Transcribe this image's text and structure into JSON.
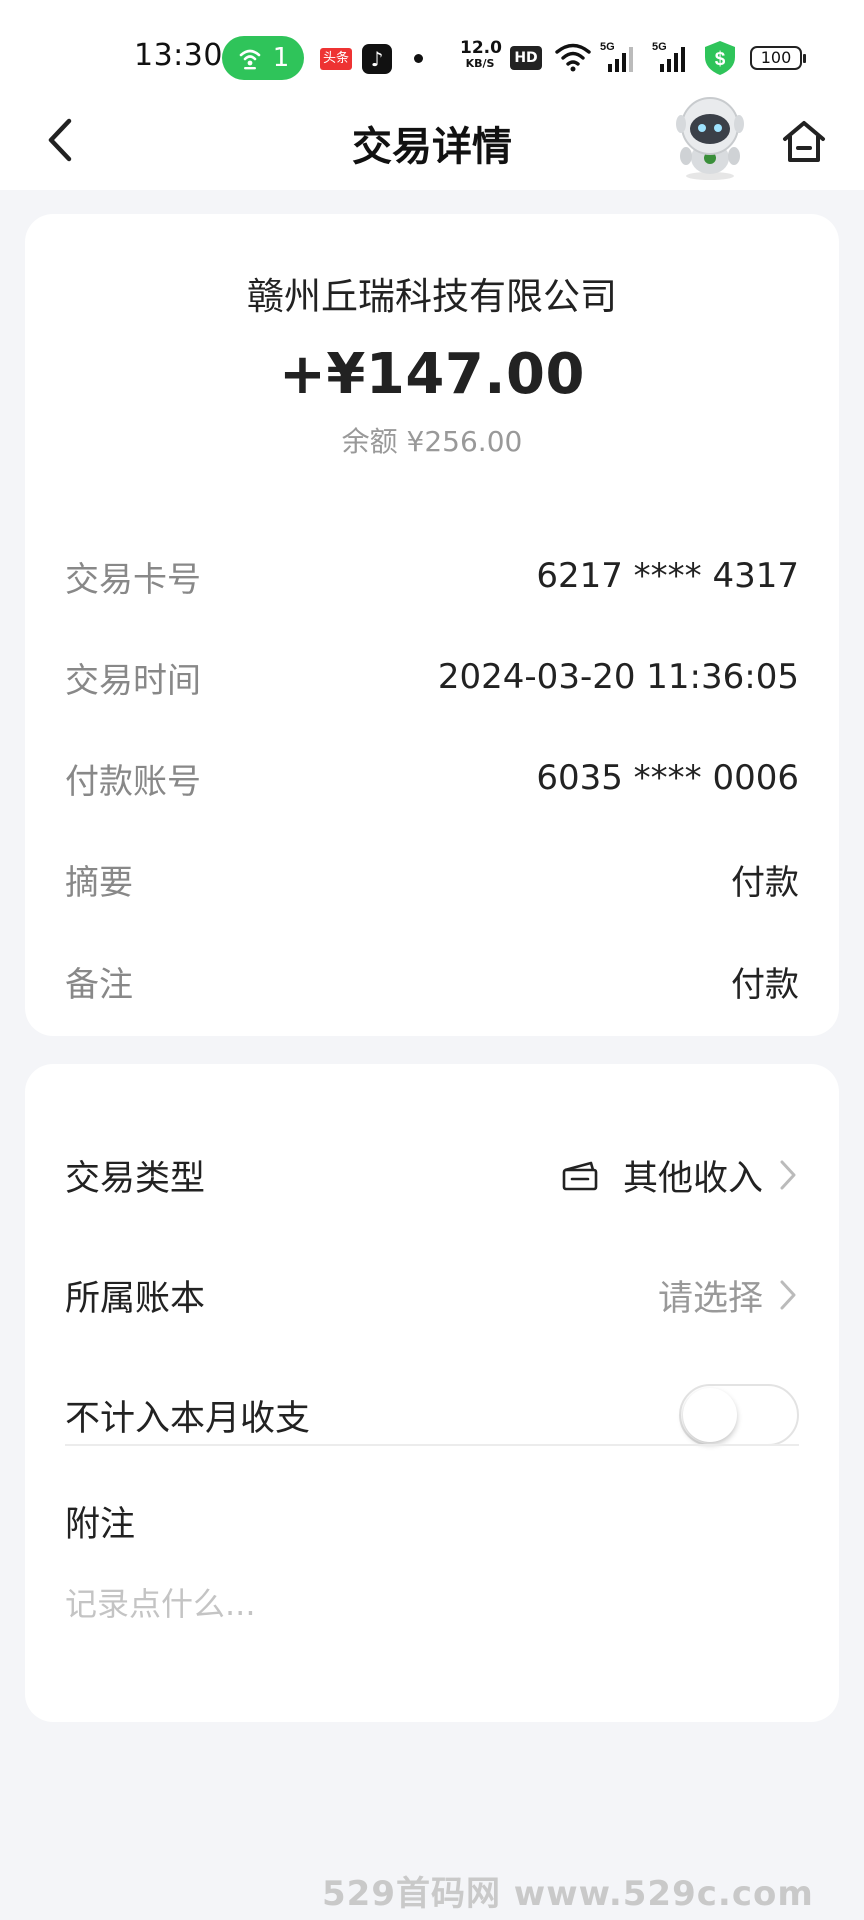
{
  "status_bar": {
    "time": "13:30",
    "hotspot_count": "1",
    "toutiao_label": "头条",
    "net_speed_value": "12.0",
    "net_speed_unit": "KB/S",
    "hd_label": "HD",
    "battery": "100",
    "icons": [
      "hotspot-icon",
      "toutiao-icon",
      "tiktok-icon",
      "wifi-icon",
      "signal-5g-icon",
      "signal-5g-icon",
      "security-shield-icon",
      "battery-icon"
    ]
  },
  "nav": {
    "title": "交易详情",
    "back_icon": "chevron-left-icon",
    "assistant_icon": "robot-assistant-icon",
    "home_icon": "home-icon"
  },
  "transaction": {
    "merchant": "赣州丘瑞科技有限公司",
    "amount": "+¥147.00",
    "balance": "余额 ¥256.00",
    "details": [
      {
        "label": "交易卡号",
        "value": "6217 **** 4317"
      },
      {
        "label": "交易时间",
        "value": "2024-03-20 11:36:05"
      },
      {
        "label": "付款账号",
        "value": "6035 **** 0006"
      },
      {
        "label": "摘要",
        "value": "付款"
      },
      {
        "label": "备注",
        "value": "付款"
      }
    ]
  },
  "settings": {
    "type_label": "交易类型",
    "type_value": "其他收入",
    "ledger_label": "所属账本",
    "ledger_value": "请选择",
    "exclude_label": "不计入本月收支",
    "exclude_enabled": false,
    "note_label": "附注",
    "note_placeholder": "记录点什么..."
  },
  "watermark": "529首码网   www.529c.com",
  "colors": {
    "background": "#f4f5f8",
    "card": "#ffffff",
    "hotspot_green": "#2fc45a",
    "shield_green": "#2fc45a",
    "label_gray": "#888888"
  }
}
